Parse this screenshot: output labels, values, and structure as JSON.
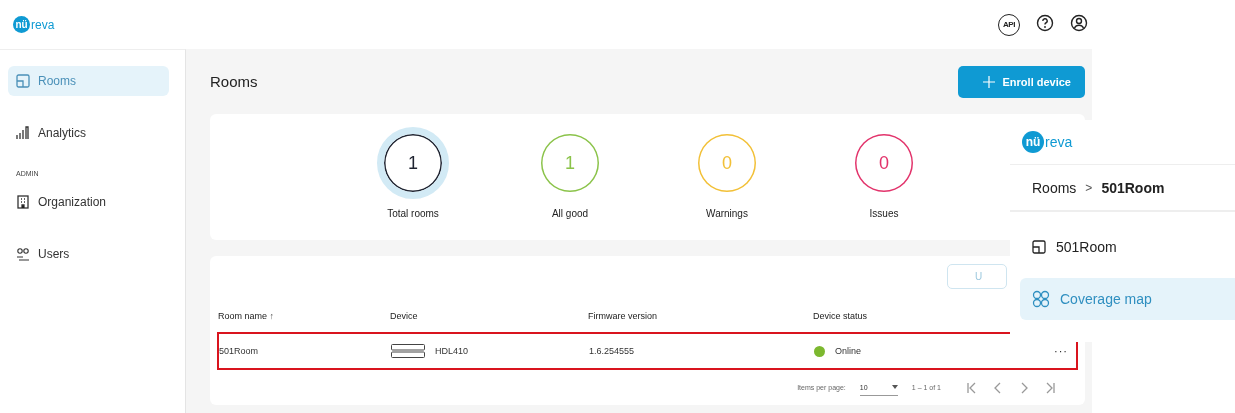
{
  "header": {
    "logo": {
      "mark": "nü",
      "word": "reva"
    },
    "icons": [
      {
        "kind": "api",
        "label": "API"
      },
      {
        "kind": "help"
      },
      {
        "kind": "account"
      }
    ]
  },
  "sidebar": {
    "items": [
      {
        "label": "Rooms",
        "kind": "room",
        "selected": true
      },
      {
        "label": "Analytics",
        "kind": "chart",
        "selected": false
      }
    ],
    "section": "ADMIN",
    "admin_items": [
      {
        "label": "Organization",
        "kind": "building",
        "selected": false
      },
      {
        "label": "Users",
        "kind": "users",
        "selected": false
      }
    ]
  },
  "main": {
    "title": "Rooms",
    "enroll_button": "Enroll device",
    "stats": [
      {
        "value": "1",
        "label": "Total rooms",
        "color": "#1f2330",
        "selected": true
      },
      {
        "value": "1",
        "label": "All good",
        "color": "#8bc34a",
        "selected": false
      },
      {
        "value": "0",
        "label": "Warnings",
        "color": "#f2c037",
        "selected": false
      },
      {
        "value": "0",
        "label": "Issues",
        "color": "#e2336b",
        "selected": false
      }
    ],
    "partial_button": "U",
    "table": {
      "columns": [
        "Room name",
        "Device",
        "Firmware version",
        "Device status"
      ],
      "sort_icon": "↑",
      "rows": [
        {
          "room": "501Room",
          "device": "HDL410",
          "firmware": "1.6.254555",
          "status": "Online",
          "color": "#7cb82f",
          "highlighted": true,
          "more": "···"
        }
      ],
      "paginator": {
        "items_label": "Items per page:",
        "page_size": "10",
        "range": "1 – 1 of 1"
      }
    }
  },
  "overlay": {
    "logo": {
      "mark": "nü",
      "word": "reva"
    },
    "breadcrumb": [
      "Rooms",
      "501Room"
    ],
    "separator": ">",
    "items": [
      {
        "label": "501Room",
        "kind": "room",
        "selected": false
      },
      {
        "label": "Coverage map",
        "kind": "rings",
        "selected": true
      }
    ]
  }
}
